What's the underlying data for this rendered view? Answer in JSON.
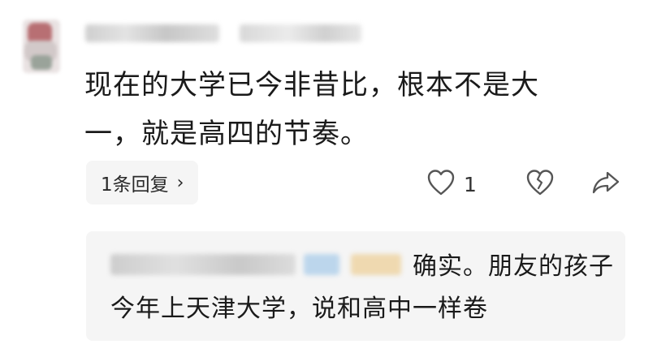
{
  "comment": {
    "text": "现在的大学已今非昔比，根本不是大一，就是高四的节奏。",
    "replies_label": "1条回复",
    "replies_chevron": "›",
    "like_count": "1",
    "icons": {
      "like": "heart-outline-icon",
      "dislike": "broken-heart-icon",
      "share": "share-arrow-icon"
    }
  },
  "reply": {
    "text": "确实。朋友的孩子今年上天津大学，说和高中一样卷"
  }
}
